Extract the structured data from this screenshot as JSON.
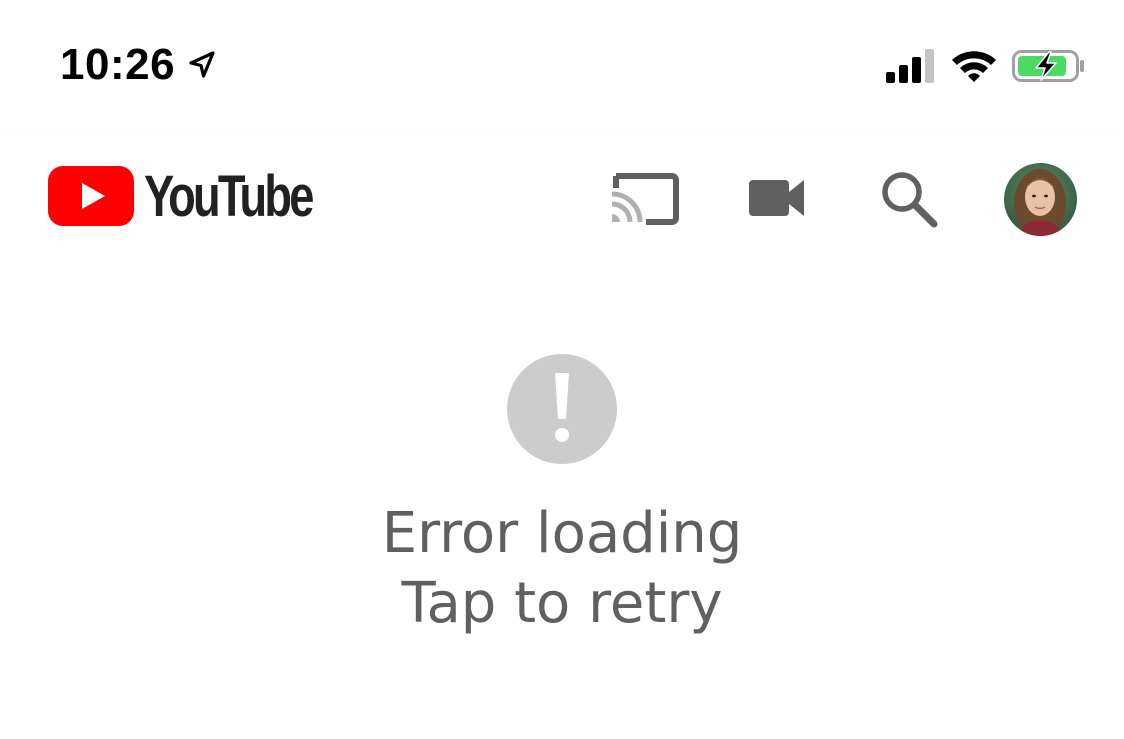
{
  "status_bar": {
    "time": "10:26",
    "location_icon": "location-arrow-icon",
    "signal_icon": "cellular-signal-icon",
    "wifi_icon": "wifi-icon",
    "battery_icon": "battery-charging-icon",
    "battery_color": "#4cd964"
  },
  "app_bar": {
    "brand": "YouTube",
    "brand_color": "#ff0000",
    "icons": {
      "cast": "cast-icon",
      "camera": "video-camera-icon",
      "search": "search-icon"
    },
    "icon_color": "#606060"
  },
  "error": {
    "icon": "exclamation-circle-icon",
    "icon_color": "#cccccc",
    "line1": "Error loading",
    "line2": "Tap to retry",
    "text_color": "#606060"
  }
}
